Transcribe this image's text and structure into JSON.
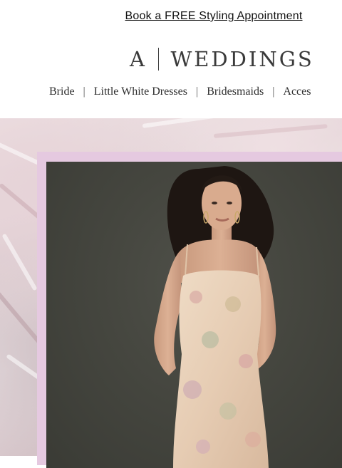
{
  "promo": {
    "link_text": "Book a FREE Styling Appointment"
  },
  "brand": {
    "logo_letter": "A",
    "logo_word": "WEDDINGS"
  },
  "nav": {
    "items": [
      {
        "label": "Bride"
      },
      {
        "label": "Little White Dresses"
      },
      {
        "label": "Bridesmaids"
      },
      {
        "label": "Acces"
      }
    ],
    "separator": "|"
  },
  "hero": {
    "frame_color": "#e5c9e0",
    "backdrop_color": "#45463f",
    "image_subject": "model in sequined floral slip dress"
  }
}
